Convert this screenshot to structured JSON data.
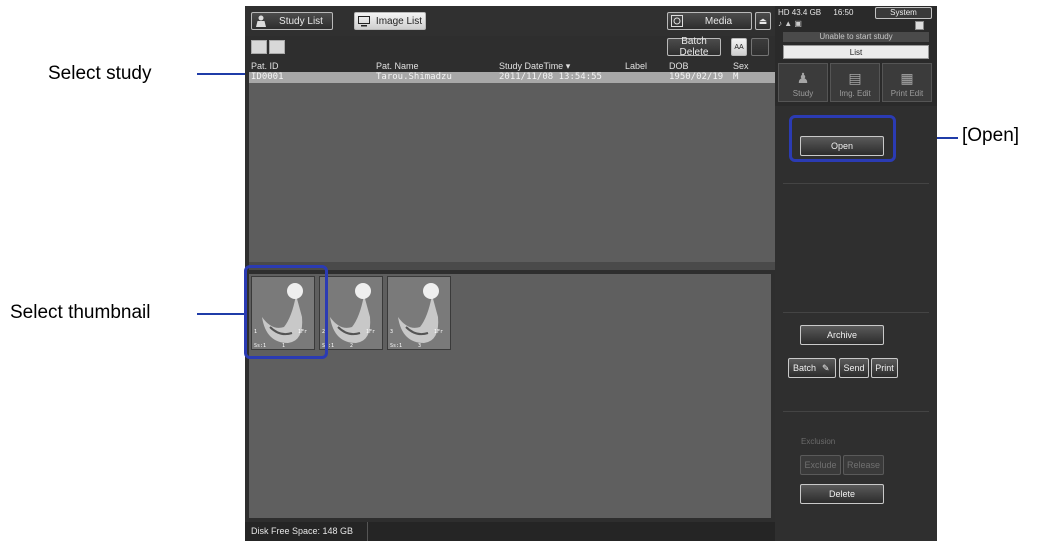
{
  "annotations": {
    "select_study": "Select study",
    "select_thumbnail": "Select thumbnail",
    "open": "[Open]"
  },
  "topbar": {
    "study_list": "Study List",
    "image_list": "Image List",
    "media": "Media"
  },
  "toolbar": {
    "batch_delete": "Batch Delete",
    "aa": "AA"
  },
  "table": {
    "headers": [
      "Pat. ID",
      "Pat. Name",
      "Study DateTime ▾",
      "Label",
      "DOB",
      "Sex"
    ],
    "rows": [
      [
        "ID0001",
        "Tarou.Shimadzu",
        "2011/11/08 13:54:55",
        "",
        "1950/02/19",
        "M"
      ]
    ]
  },
  "thumbnails": [
    {
      "index": "1",
      "frames": "1Fr",
      "series": "Ss:1",
      "num": "1"
    },
    {
      "index": "2",
      "frames": "1Fr",
      "series": "Ss:1",
      "num": "2"
    },
    {
      "index": "3",
      "frames": "1Fr",
      "series": "Ss:1",
      "num": "3"
    }
  ],
  "status": {
    "disk_free": "Disk Free Space: 148 GB"
  },
  "right_panel": {
    "hd": "HD 43.4 GB",
    "time": "16:50",
    "system": "System",
    "warning": "Unable to start study",
    "list": "List",
    "modes": [
      "Study",
      "Img. Edit",
      "Print Edit"
    ],
    "open": "Open",
    "archive": "Archive",
    "batch": "Batch",
    "send": "Send",
    "print": "Print",
    "exclusion": "Exclusion",
    "exclude": "Exclude",
    "release": "Release",
    "delete": "Delete"
  },
  "colors": {
    "highlight": "#2b3bb3",
    "selected_row": "#a8a8a8"
  }
}
